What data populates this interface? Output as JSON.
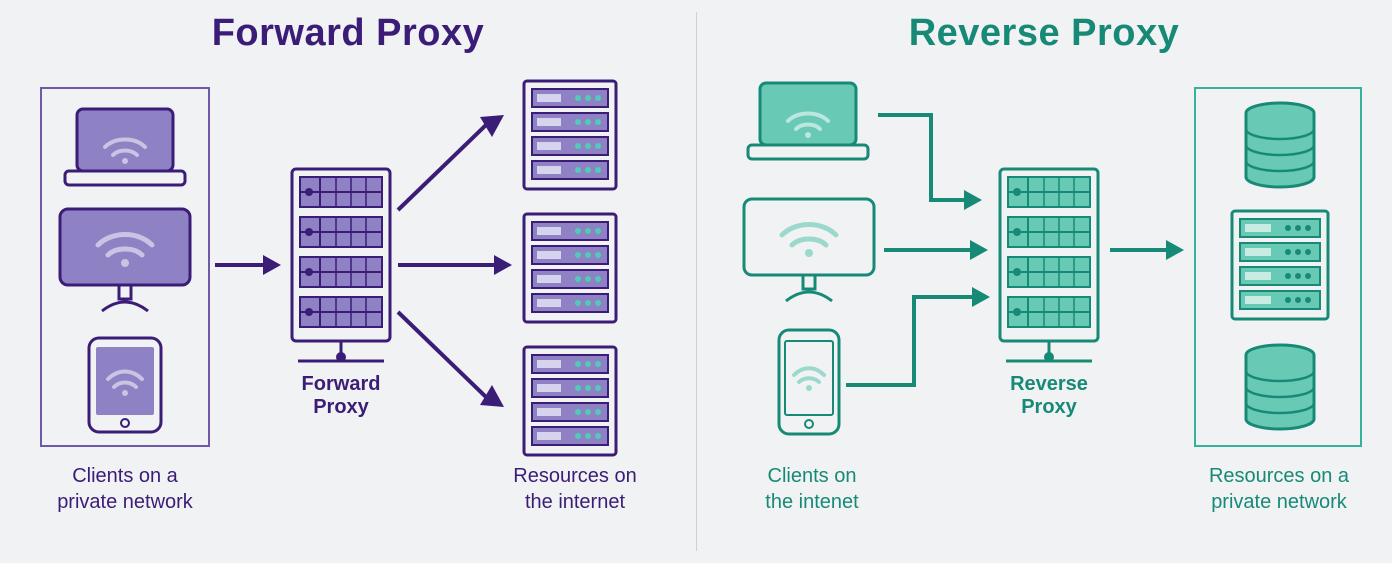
{
  "diagram": {
    "type": "network-topology-comparison",
    "sections": [
      "forward_proxy",
      "reverse_proxy"
    ]
  },
  "forward": {
    "title": "Forward Proxy",
    "proxy_label": "Forward\nProxy",
    "clients_caption": "Clients on a\nprivate network",
    "resources_caption": "Resources on\nthe internet",
    "client_devices": [
      "laptop",
      "desktop",
      "tablet"
    ],
    "resources": [
      "server-rack",
      "server-rack",
      "server-rack"
    ],
    "clients_in_box": true,
    "resources_in_box": false,
    "colors": {
      "stroke": "#3b1d78",
      "fill": "#8e82c4",
      "accent": "#51cbb5"
    }
  },
  "reverse": {
    "title": "Reverse Proxy",
    "proxy_label": "Reverse\nProxy",
    "clients_caption": "Clients on\nthe intenet",
    "resources_caption": "Resources on a\nprivate network",
    "client_devices": [
      "laptop",
      "desktop",
      "phone"
    ],
    "resources": [
      "database-cylinder",
      "server-rack",
      "database-cylinder"
    ],
    "clients_in_box": false,
    "resources_in_box": true,
    "colors": {
      "stroke": "#178a77",
      "fill": "#68c9b4",
      "accent": "#178a77"
    }
  }
}
